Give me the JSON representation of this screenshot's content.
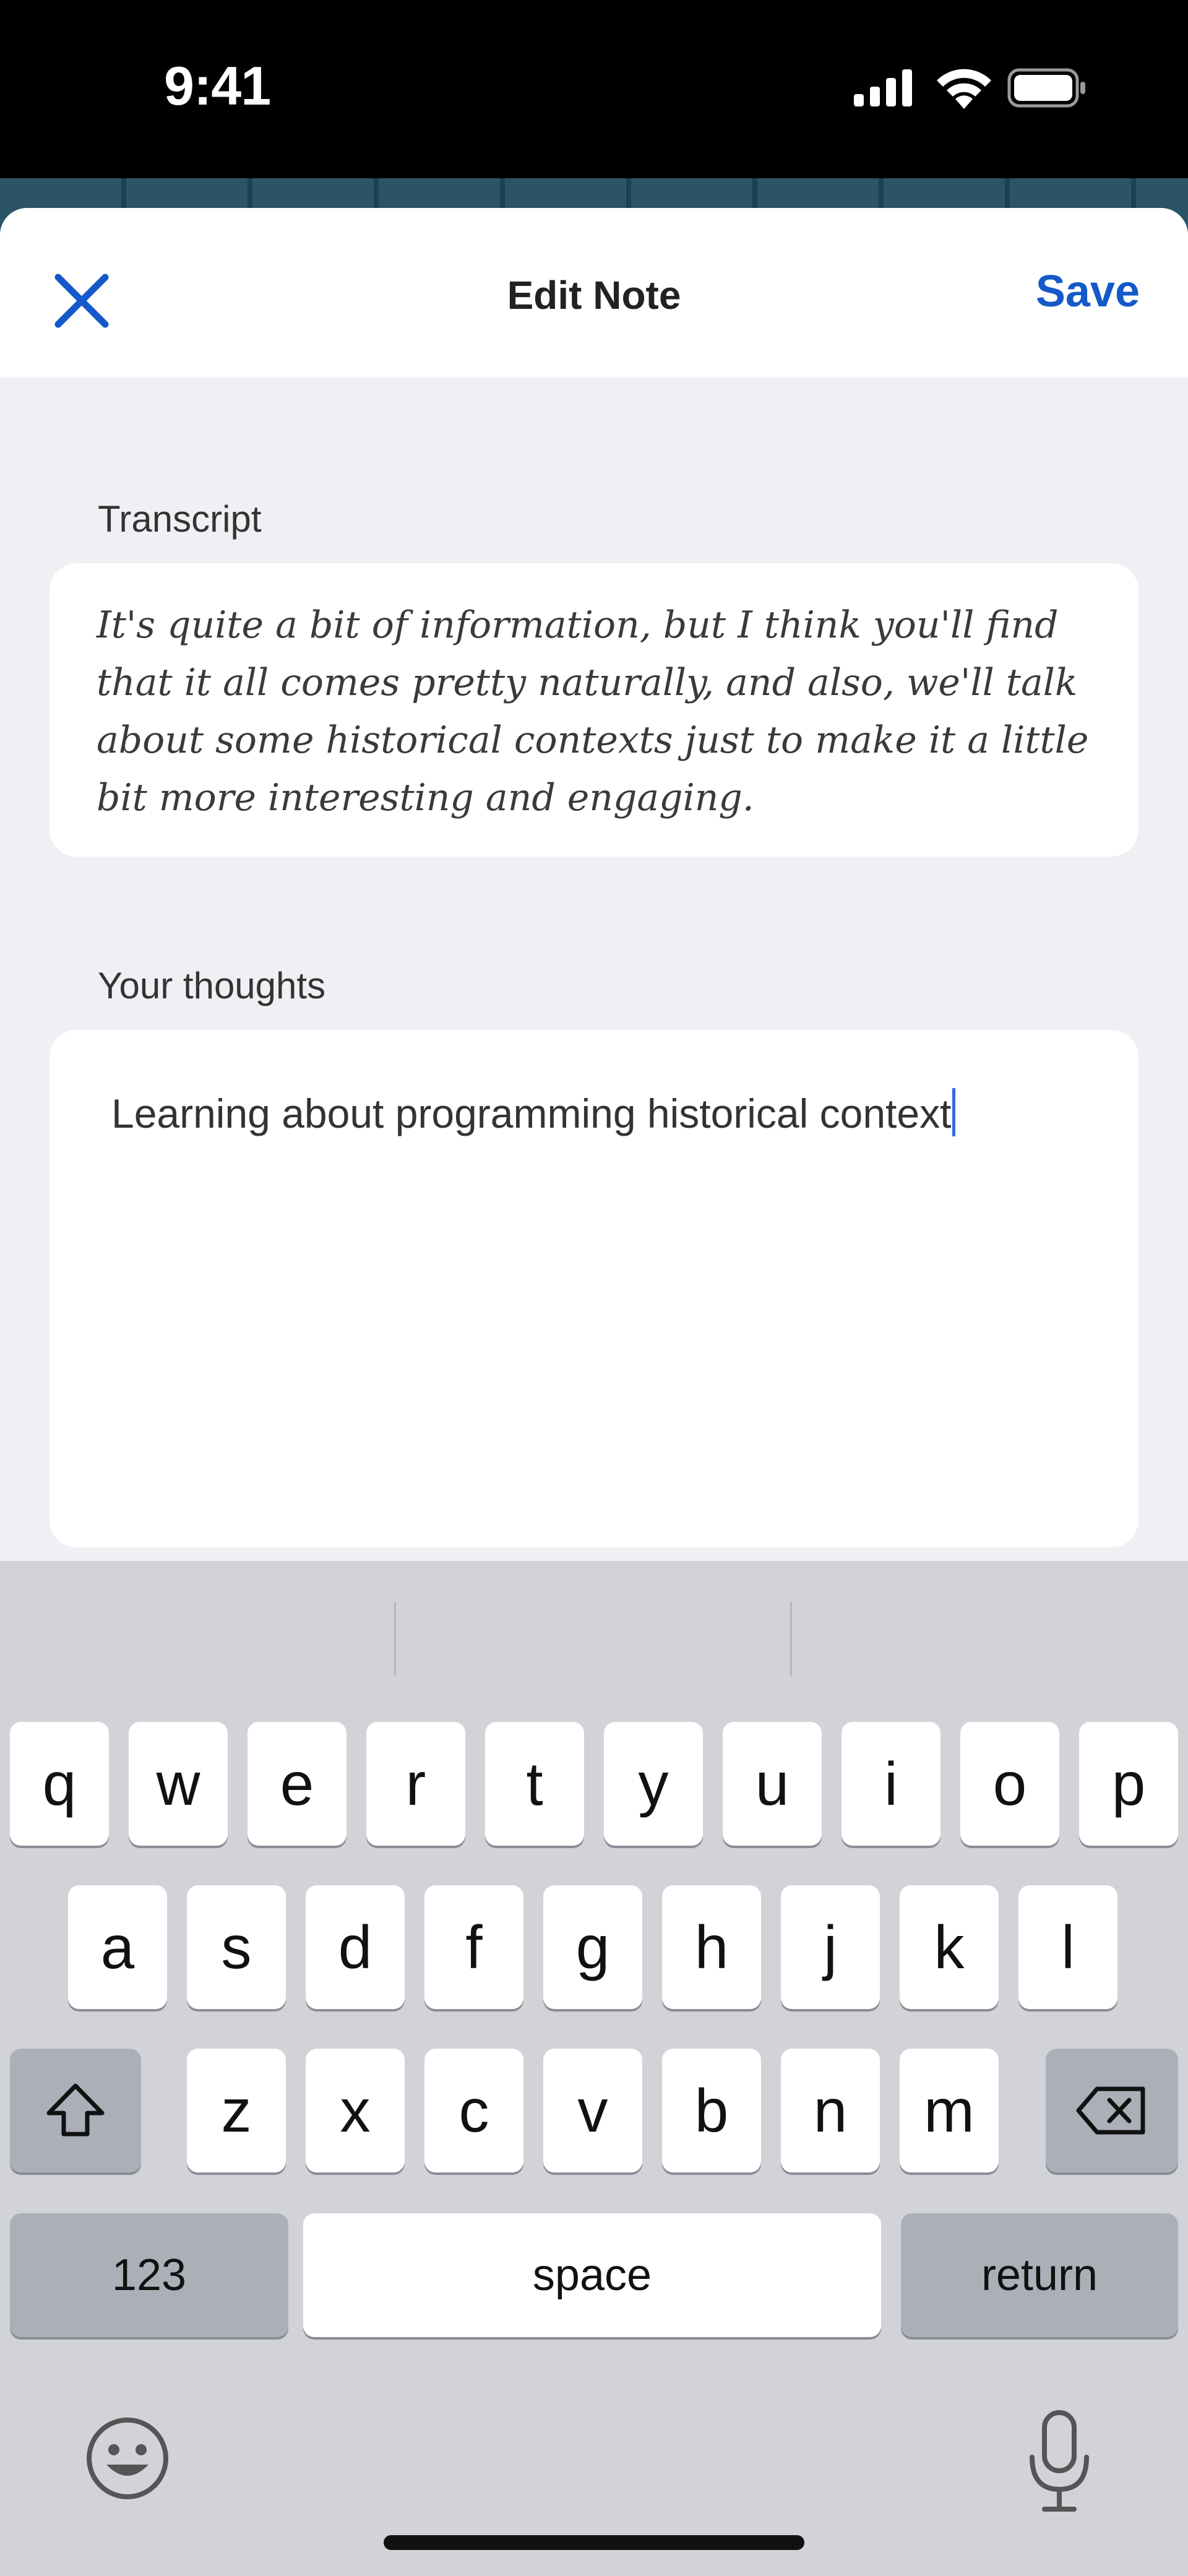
{
  "status_bar": {
    "time": "9:41",
    "icons": [
      "cellular-signal-icon",
      "wifi-icon",
      "battery-icon"
    ]
  },
  "nav": {
    "title": "Edit Note",
    "close_icon": "close-icon",
    "save_label": "Save"
  },
  "transcript": {
    "label": "Transcript",
    "text": "It's quite a bit of information, but I think you'll find that it all comes pretty naturally, and also, we'll talk about some historical contexts just to make it a little bit more interesting and engaging."
  },
  "thoughts": {
    "label": "Your thoughts",
    "value": "Learning about programming historical context"
  },
  "keyboard": {
    "row1": [
      "q",
      "w",
      "e",
      "r",
      "t",
      "y",
      "u",
      "i",
      "o",
      "p"
    ],
    "row2": [
      "a",
      "s",
      "d",
      "f",
      "g",
      "h",
      "j",
      "k",
      "l"
    ],
    "row3": [
      "z",
      "x",
      "c",
      "v",
      "b",
      "n",
      "m"
    ],
    "numbers_label": "123",
    "space_label": "space",
    "return_label": "return"
  },
  "colors": {
    "accent": "#1459c9",
    "keyboard_bg": "#d1d3d9",
    "sheet_bg": "#f0f0f4"
  }
}
